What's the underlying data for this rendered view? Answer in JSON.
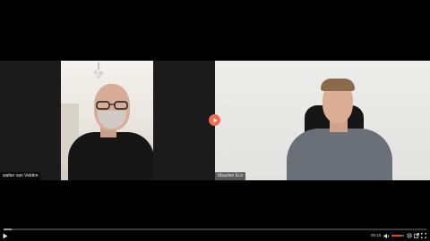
{
  "participants": [
    {
      "name": "walter van Velden"
    },
    {
      "name": "Maarten Eco"
    }
  ],
  "player": {
    "time": "00:15",
    "progress": 0.02,
    "volume": 0.8,
    "accent_color": "#f26a4f",
    "icons": [
      "play-icon",
      "volume-icon",
      "settings-icon",
      "external-link-icon",
      "fullscreen-icon"
    ]
  }
}
